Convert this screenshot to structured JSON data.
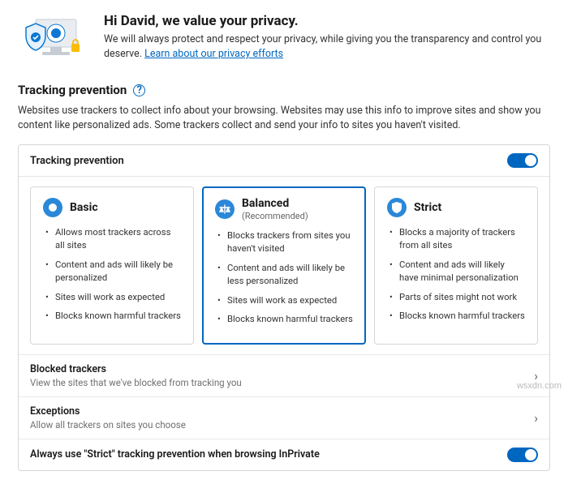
{
  "hero": {
    "title": "Hi David, we value your privacy.",
    "desc": "We will always protect and respect your privacy, while giving you the transparency and control you deserve. ",
    "link": "Learn about our privacy efforts"
  },
  "section": {
    "title": "Tracking prevention",
    "desc": "Websites use trackers to collect info about your browsing. Websites may use this info to improve sites and show you content like personalized ads. Some trackers collect and send your info to sites you haven't visited."
  },
  "panel": {
    "header_label": "Tracking prevention",
    "toggle_on": true,
    "levels": [
      {
        "id": "basic",
        "title": "Basic",
        "subtitle": "",
        "bullets": [
          "Allows most trackers across all sites",
          "Content and ads will likely be personalized",
          "Sites will work as expected",
          "Blocks known harmful trackers"
        ]
      },
      {
        "id": "balanced",
        "title": "Balanced",
        "subtitle": "(Recommended)",
        "bullets": [
          "Blocks trackers from sites you haven't visited",
          "Content and ads will likely be less personalized",
          "Sites will work as expected",
          "Blocks known harmful trackers"
        ]
      },
      {
        "id": "strict",
        "title": "Strict",
        "subtitle": "",
        "bullets": [
          "Blocks a majority of trackers from all sites",
          "Content and ads will likely have minimal personalization",
          "Parts of sites might not work",
          "Blocks known harmful trackers"
        ]
      }
    ],
    "selected": "balanced",
    "rows": {
      "blocked": {
        "title": "Blocked trackers",
        "desc": "View the sites that we've blocked from tracking you"
      },
      "exceptions": {
        "title": "Exceptions",
        "desc": "Allow all trackers on sites you choose"
      },
      "inprivate": {
        "title": "Always use \"Strict\" tracking prevention when browsing InPrivate",
        "on": true
      }
    }
  },
  "watermark": "wsxdn.com"
}
